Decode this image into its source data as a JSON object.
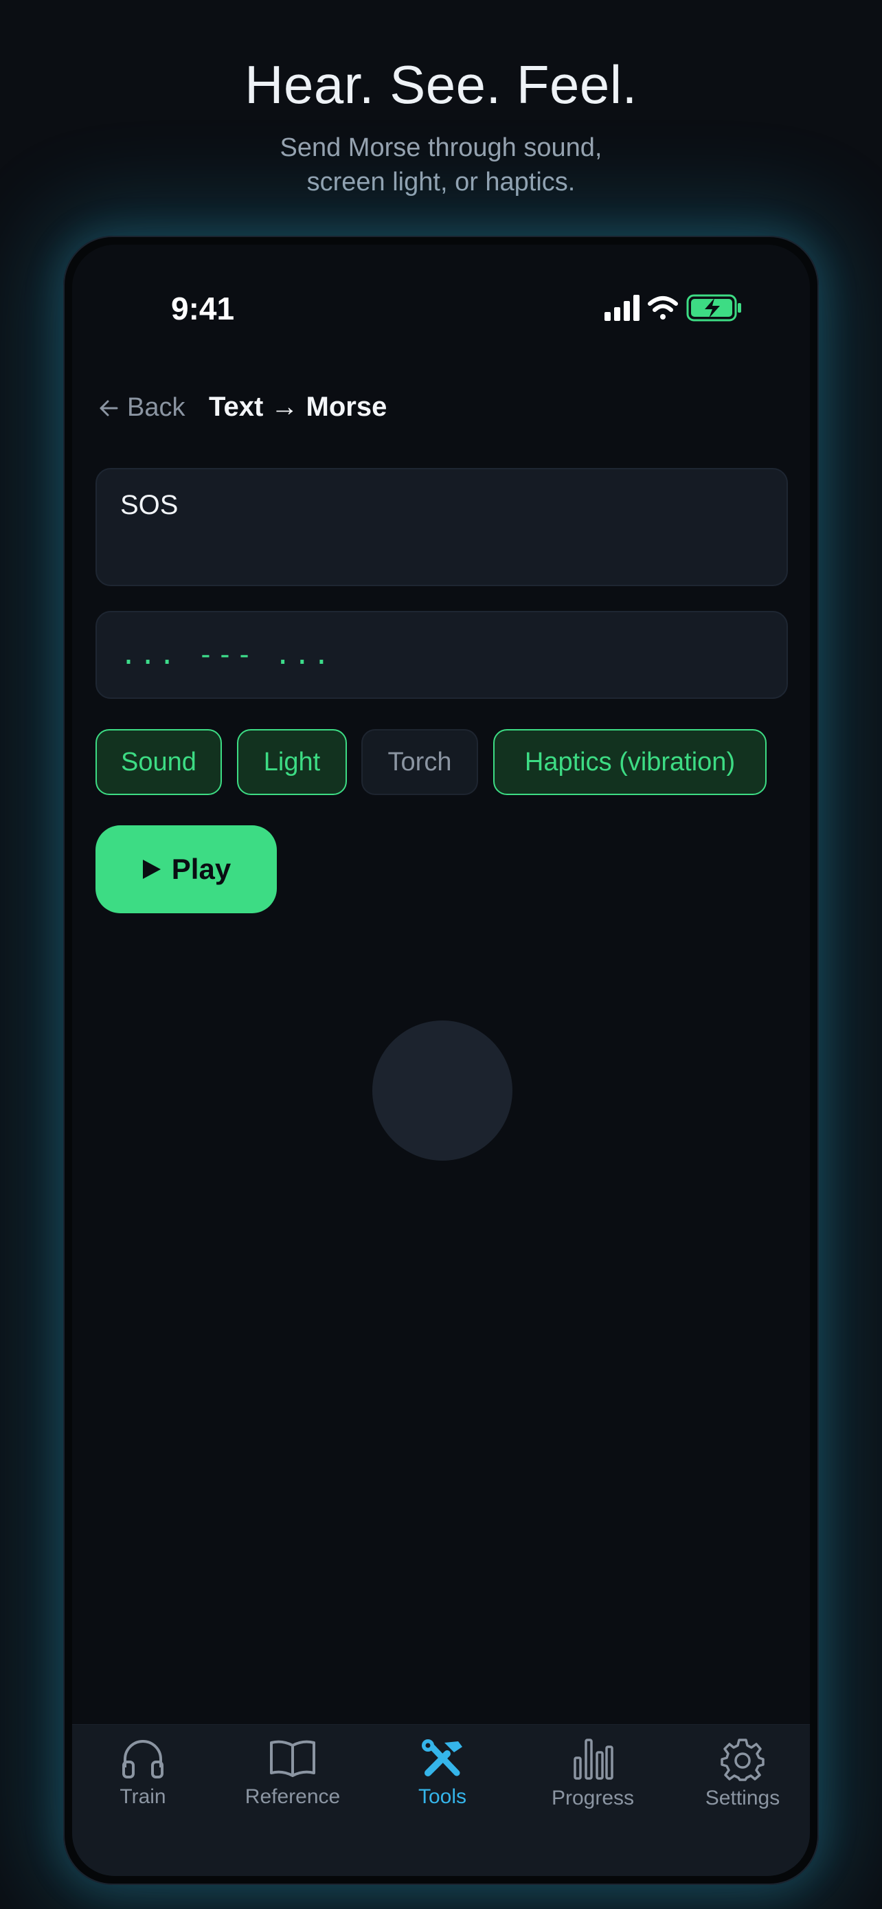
{
  "hero": {
    "title": "Hear. See. Feel.",
    "subtitle_line1": "Send Morse through sound,",
    "subtitle_line2": "screen light, or haptics."
  },
  "status_bar": {
    "time": "9:41",
    "icons": [
      "signal-icon",
      "wifi-icon",
      "battery-charging-icon"
    ]
  },
  "header": {
    "back_label": "Back",
    "title": "Text → Morse"
  },
  "input": {
    "value": "SOS"
  },
  "output": {
    "morse": "... --- ..."
  },
  "modes": [
    {
      "label": "Sound",
      "selected": true
    },
    {
      "label": "Light",
      "selected": true
    },
    {
      "label": "Torch",
      "selected": false
    },
    {
      "label": "Haptics (vibration)",
      "selected": true
    }
  ],
  "play_button": {
    "label": "Play"
  },
  "tabbar": {
    "tabs": [
      {
        "label": "Train",
        "icon": "headphones-icon",
        "active": false
      },
      {
        "label": "Reference",
        "icon": "book-icon",
        "active": false
      },
      {
        "label": "Tools",
        "icon": "tools-icon",
        "active": true
      },
      {
        "label": "Progress",
        "icon": "bar-chart-icon",
        "active": false
      },
      {
        "label": "Settings",
        "icon": "gear-icon",
        "active": false
      }
    ]
  },
  "colors": {
    "accent_green": "#3ddc84",
    "accent_blue": "#35b5ea",
    "background": "#0a0d12"
  }
}
